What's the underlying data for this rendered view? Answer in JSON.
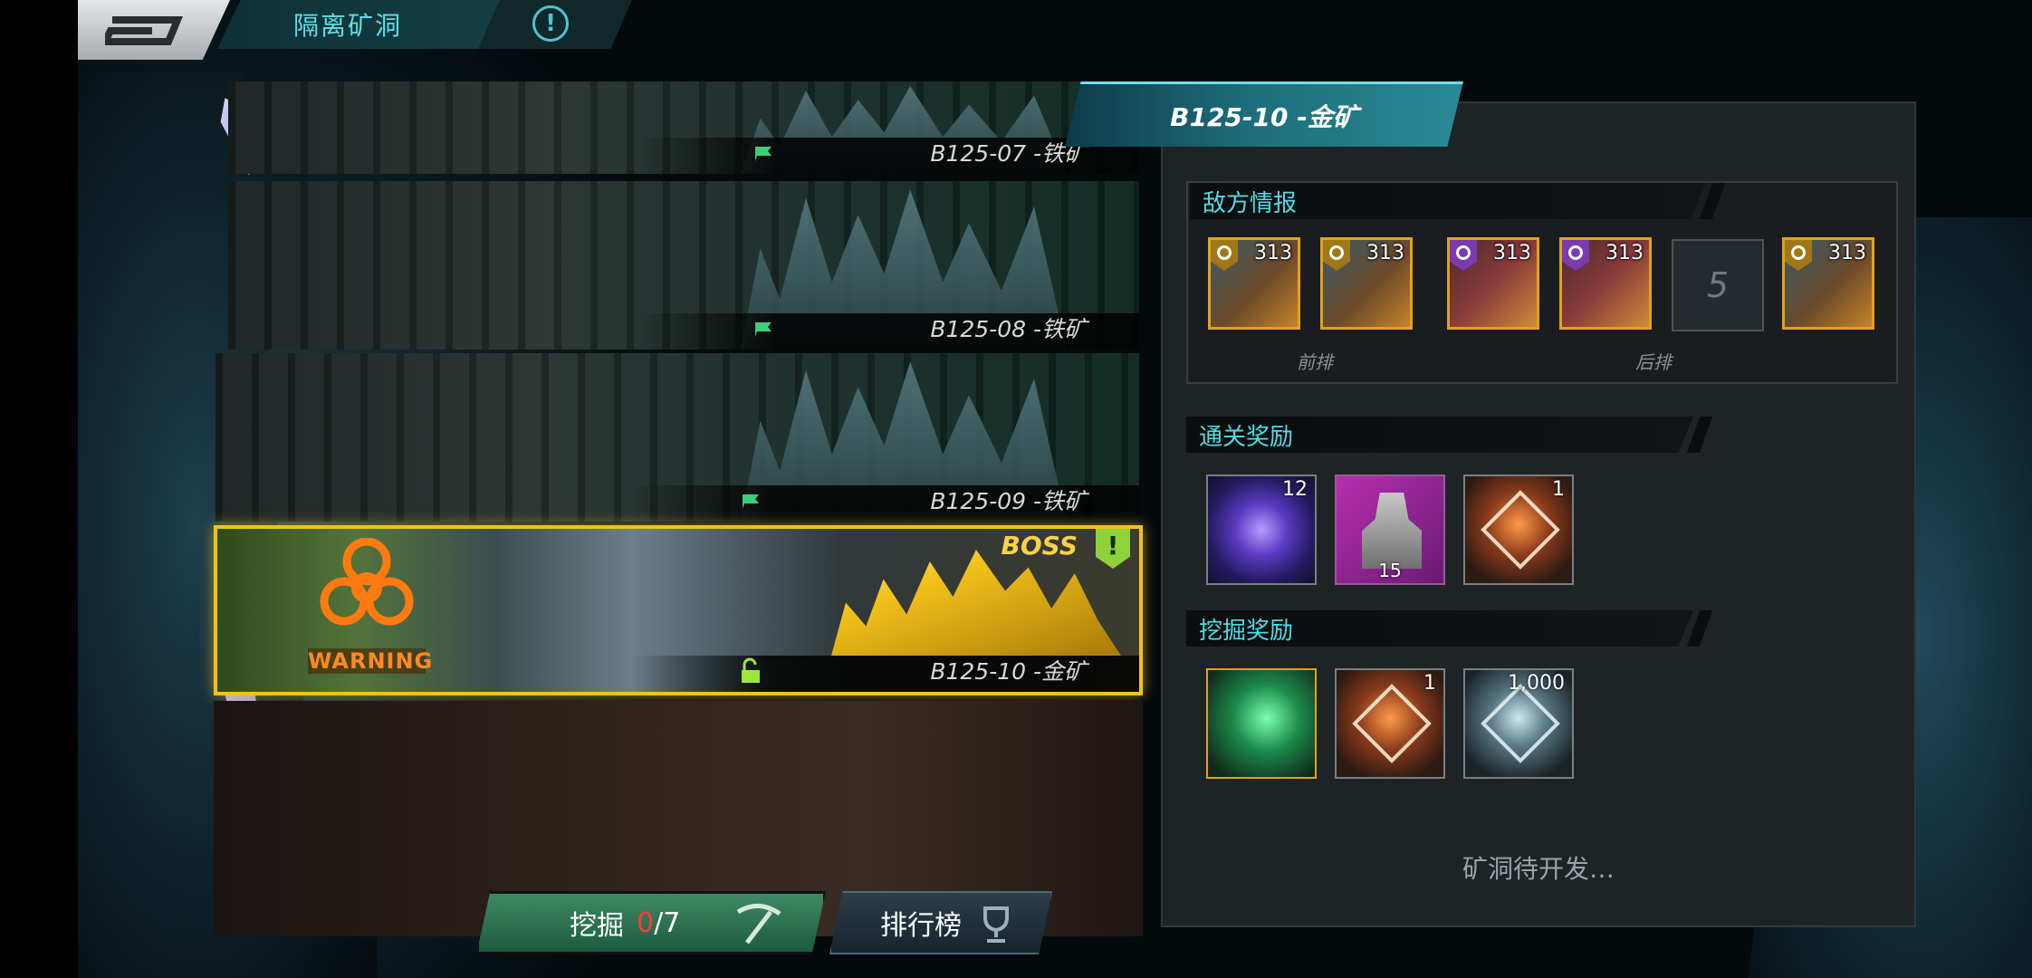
{
  "header": {
    "title": "隔离矿洞",
    "back_icon": "back-icon",
    "info_icon": "exclamation-info-icon"
  },
  "levels": [
    {
      "name": "B125-07 -铁矿",
      "flag_icon": "flag-icon"
    },
    {
      "name": "B125-08 -铁矿",
      "flag_icon": "flag-icon"
    },
    {
      "name": "B125-09 -铁矿",
      "flag_icon": "flag-icon"
    },
    {
      "name": "B125-10 -金矿",
      "boss_label": "BOSS",
      "warning_label": "WARNING",
      "excl": "!",
      "lock_icon": "unlock-icon"
    }
  ],
  "buttons": {
    "dig_label": "挖掘",
    "dig_count_current": "0",
    "dig_count_total": "/7",
    "rank_label": "排行榜"
  },
  "panel": {
    "title": "B125-10 -金矿",
    "enemy_section": "敌方情报",
    "enemies": [
      {
        "level": "313",
        "faction": "yellow"
      },
      {
        "level": "313",
        "faction": "yellow"
      },
      {
        "level": "313",
        "faction": "purple"
      },
      {
        "level": "313",
        "faction": "purple"
      },
      {
        "level": "313",
        "faction": "yellow"
      }
    ],
    "empty_slot": "5",
    "front_row": "前排",
    "back_row": "后排",
    "clear_reward_section": "通关奖励",
    "clear_rewards": [
      {
        "qty": "12",
        "icon": "purple-core-icon"
      },
      {
        "qty": "15",
        "icon": "character-shard-icon"
      },
      {
        "qty": "1",
        "icon": "orange-crystal-icon"
      }
    ],
    "dig_reward_section": "挖掘奖励",
    "dig_rewards": [
      {
        "qty": "",
        "icon": "green-ore-icon"
      },
      {
        "qty": "1",
        "icon": "orange-crystal-icon"
      },
      {
        "qty": "1,000",
        "icon": "silver-crystal-icon"
      }
    ],
    "status": "矿洞待开发…"
  },
  "colors": {
    "accent": "#4fdde6",
    "boss_border": "#f2c21a",
    "dig_button": "#2f7a55",
    "counter_red": "#ff3b3b"
  }
}
